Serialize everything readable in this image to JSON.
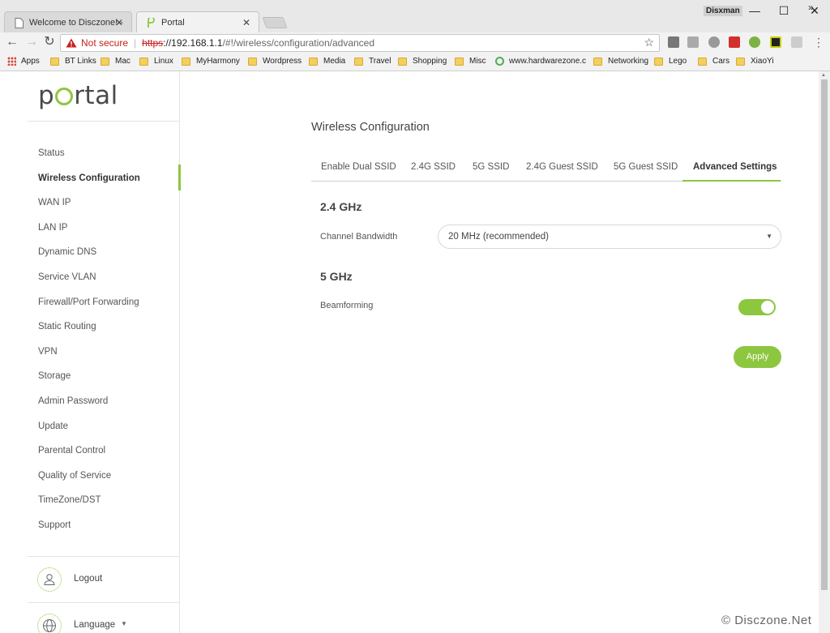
{
  "browser": {
    "tabs": [
      {
        "title": "Welcome to Disczone! -"
      },
      {
        "title": "Portal"
      }
    ],
    "profile_name": "Disxman",
    "security_label": "Not secure",
    "url_scheme": "https",
    "url_host": "://192.168.1.1",
    "url_path": "/#!/wireless/configuration/advanced",
    "bookmarks": [
      {
        "label": "Apps",
        "icon": "apps-grid-icon"
      },
      {
        "label": "BT Links",
        "icon": "folder-icon"
      },
      {
        "label": "Mac",
        "icon": "folder-icon"
      },
      {
        "label": "Linux",
        "icon": "folder-icon"
      },
      {
        "label": "MyHarmony",
        "icon": "folder-icon"
      },
      {
        "label": "Wordpress",
        "icon": "folder-icon"
      },
      {
        "label": "Media",
        "icon": "folder-icon"
      },
      {
        "label": "Travel",
        "icon": "folder-icon"
      },
      {
        "label": "Shopping",
        "icon": "folder-icon"
      },
      {
        "label": "Misc",
        "icon": "folder-icon"
      },
      {
        "label": "www.hardwarezone.c",
        "icon": "site-icon"
      },
      {
        "label": "Networking",
        "icon": "folder-icon"
      },
      {
        "label": "Lego",
        "icon": "folder-icon"
      },
      {
        "label": "Cars",
        "icon": "folder-icon"
      },
      {
        "label": "XiaoYi",
        "icon": "folder-icon"
      }
    ]
  },
  "sidebar": {
    "logo": "portal",
    "items": [
      {
        "label": "Status"
      },
      {
        "label": "Wireless Configuration"
      },
      {
        "label": "WAN IP"
      },
      {
        "label": "LAN IP"
      },
      {
        "label": "Dynamic DNS"
      },
      {
        "label": "Service VLAN"
      },
      {
        "label": "Firewall/Port Forwarding"
      },
      {
        "label": "Static Routing"
      },
      {
        "label": "VPN"
      },
      {
        "label": "Storage"
      },
      {
        "label": "Admin Password"
      },
      {
        "label": "Update"
      },
      {
        "label": "Parental Control"
      },
      {
        "label": "Quality of Service"
      },
      {
        "label": "TimeZone/DST"
      },
      {
        "label": "Support"
      }
    ],
    "active_item": "Wireless Configuration",
    "logout_label": "Logout",
    "language_label": "Language"
  },
  "main": {
    "title": "Wireless Configuration",
    "tabs": [
      {
        "label": "Enable Dual SSID"
      },
      {
        "label": "2.4G SSID"
      },
      {
        "label": "5G SSID"
      },
      {
        "label": "2.4G Guest SSID"
      },
      {
        "label": "5G Guest SSID"
      },
      {
        "label": "Advanced Settings"
      }
    ],
    "active_tab": "Advanced Settings",
    "section_24": "2.4 GHz",
    "channel_bandwidth_label": "Channel Bandwidth",
    "channel_bandwidth_value": "20 MHz (recommended)",
    "section_5": "5 GHz",
    "beamforming_label": "Beamforming",
    "beamforming_enabled": true,
    "apply_label": "Apply"
  },
  "watermark": "© Disczone.Net",
  "colors": {
    "accent": "#8dc63f",
    "warning": "#c5221f"
  }
}
